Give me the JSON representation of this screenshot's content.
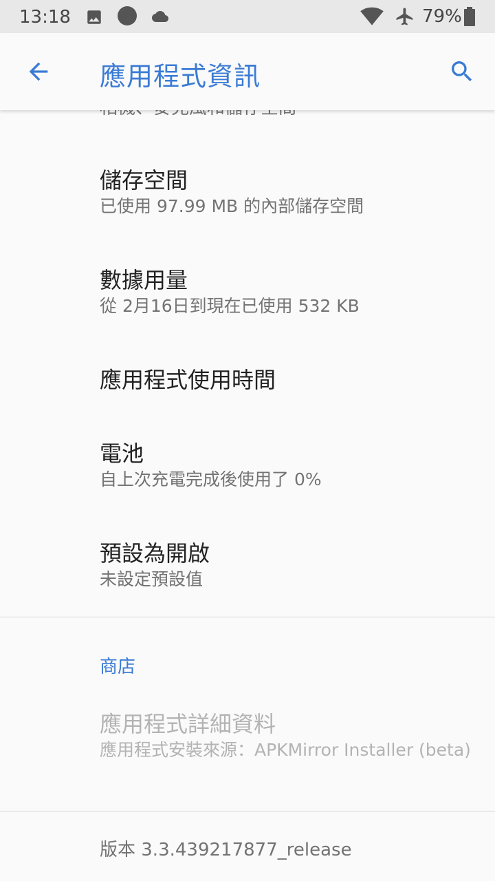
{
  "status_bar": {
    "time": "13:18",
    "battery": "79%",
    "icons": [
      "image-icon",
      "circle-icon",
      "cloud-icon",
      "wifi-icon",
      "airplane-icon",
      "battery-icon"
    ]
  },
  "app_bar": {
    "title": "應用程式資訊",
    "back_icon": "arrow-back-icon",
    "search_icon": "search-icon",
    "accent": "#3a7bd5"
  },
  "partial_item": {
    "subtitle": "相機、麥克風和儲存空間"
  },
  "items": [
    {
      "title": "儲存空間",
      "subtitle": "已使用 97.99 MB 的內部儲存空間"
    },
    {
      "title": "數據用量",
      "subtitle": "從 2月16日到現在已使用 532 KB"
    },
    {
      "title": "應用程式使用時間",
      "subtitle": ""
    },
    {
      "title": "電池",
      "subtitle": "自上次充電完成後使用了 0%"
    },
    {
      "title": "預設為開啟",
      "subtitle": "未設定預設值"
    }
  ],
  "store_section": {
    "header": "商店",
    "item": {
      "title": "應用程式詳細資料",
      "subtitle": "應用程式安裝來源：APKMirror Installer (beta)"
    }
  },
  "version": "版本 3.3.439217877_release"
}
